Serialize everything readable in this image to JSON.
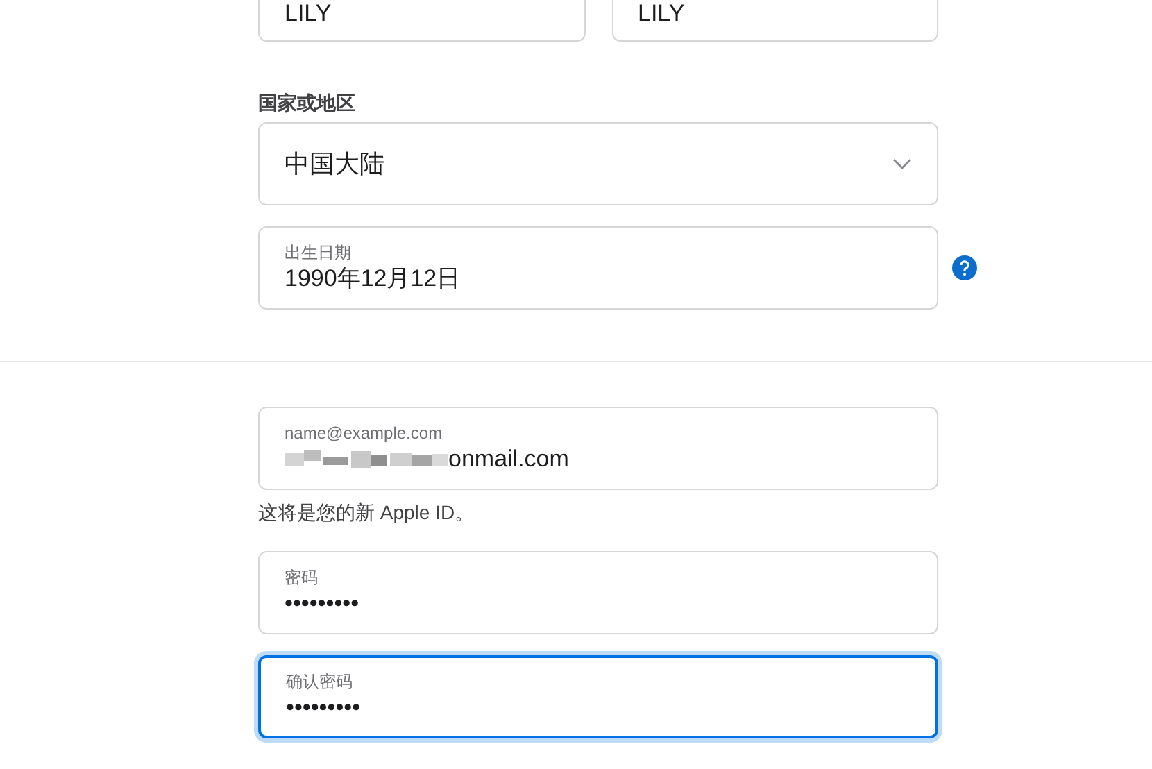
{
  "name_fields": [
    {
      "value": "LILY"
    },
    {
      "value": "LILY"
    }
  ],
  "region": {
    "label": "国家或地区",
    "value": "中国大陆"
  },
  "birthday": {
    "label": "出生日期",
    "value": "1990年12月12日",
    "help": true
  },
  "email": {
    "placeholder": "name@example.com",
    "value": "onmail.com",
    "redacted": true,
    "hint": "这将是您的新 Apple ID。"
  },
  "passwords": [
    {
      "label": "密码",
      "value": "•••••••••",
      "focused": false
    },
    {
      "label": "确认密码",
      "value": "•••••••••",
      "focused": true
    }
  ]
}
